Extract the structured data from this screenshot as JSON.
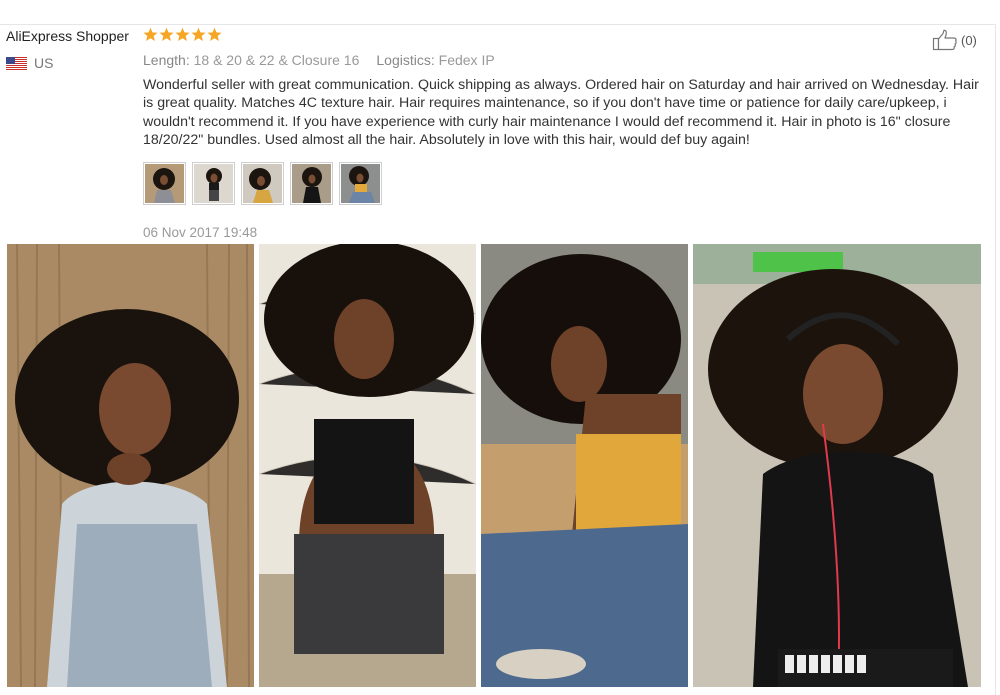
{
  "reviewer": {
    "name": "AliExpress Shopper",
    "country": "US",
    "rating": 5
  },
  "meta": {
    "length_label": "Length:",
    "length_value": "18 & 20 & 22 & Closure 16",
    "logistics_label": "Logistics:",
    "logistics_value": "Fedex IP"
  },
  "like": {
    "count": "(0)",
    "icon": "thumbs-up-icon"
  },
  "review_text": "Wonderful seller with great communication. Quick shipping as always. Ordered hair on Saturday and hair arrived on Wednesday. Hair is great quality. Matches 4C texture hair. Hair requires maintenance, so if you don't have time or patience for daily care/upkeep, i wouldn't recommend it. If you have experience with curly hair maintenance I would def recommend it. Hair in photo is 16\" closure 18/20/22\" bundles. Used almost all the hair. Absolutely in love with this hair, would def buy again!",
  "thumbnails_count": 5,
  "date": "06 Nov 2017 19:48",
  "colors": {
    "star": "#f5a623",
    "meta": "#999999",
    "border": "#e6e6e6"
  }
}
